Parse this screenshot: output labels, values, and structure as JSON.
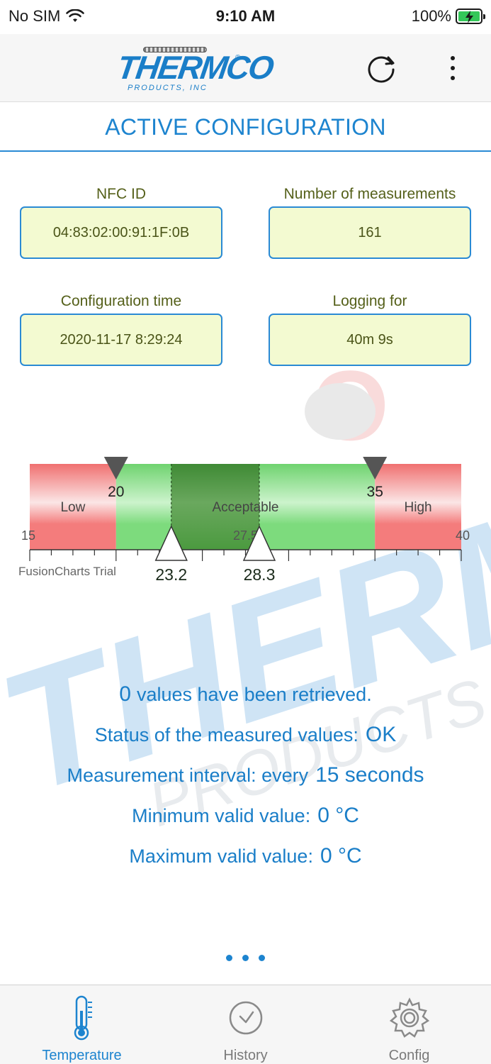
{
  "status_bar": {
    "carrier": "No SIM",
    "time": "9:10 AM",
    "battery": "100%"
  },
  "app_bar": {
    "logo_text": "THERMCO",
    "logo_sub": "PRODUCTS, INC",
    "refresh_icon": "refresh-icon",
    "more_icon": "more-vertical-icon"
  },
  "section": {
    "title": "ACTIVE CONFIGURATION"
  },
  "info": {
    "nfc_label": "NFC ID",
    "nfc_value": "04:83:02:00:91:1F:0B",
    "measurements_label": "Number of measurements",
    "measurements_value": "161",
    "config_time_label": "Configuration time",
    "config_time_value": "2020-11-17 8:29:24",
    "logging_label": "Logging for",
    "logging_value": "40m 9s"
  },
  "chart_data": {
    "type": "linear-gauge",
    "min": 15,
    "max": 40,
    "ranges": [
      {
        "label": "Low",
        "from": 15,
        "to": 20,
        "color": "#f47c7c"
      },
      {
        "label": "Acceptable",
        "from": 20,
        "to": 35,
        "color": "#7ddb7d"
      },
      {
        "label": "High",
        "from": 35,
        "to": 40,
        "color": "#f47c7c"
      }
    ],
    "threshold_markers": [
      20,
      35
    ],
    "band": {
      "from": 23.2,
      "to": 28.3,
      "color": "#4b9a3f"
    },
    "pointers": [
      {
        "value": 23.2,
        "label": "23.2"
      },
      {
        "value": 28.3,
        "label": "28.3"
      }
    ],
    "tick_labels": {
      "min": "15",
      "mid": "27.5",
      "max": "40",
      "low_threshold": "20",
      "high_threshold": "35"
    },
    "trial_label": "FusionCharts Trial"
  },
  "stats": {
    "retrieved_count": "0",
    "retrieved_text": "values have been retrieved.",
    "status_label": "Status of the measured values:",
    "status_value": "OK",
    "interval_label": "Measurement interval: every",
    "interval_value": "15 seconds",
    "min_label": "Minimum valid value:",
    "min_value": "0 °C",
    "max_label": "Maximum valid value:",
    "max_value": "0 °C"
  },
  "tabs": [
    {
      "label": "Temperature",
      "icon": "thermometer-icon",
      "active": true
    },
    {
      "label": "History",
      "icon": "clock-icon",
      "active": false
    },
    {
      "label": "Config",
      "icon": "gear-icon",
      "active": false
    }
  ],
  "colors": {
    "accent": "#1d84cf",
    "field_bg": "#f3fad1",
    "label_olive": "#55601a"
  }
}
